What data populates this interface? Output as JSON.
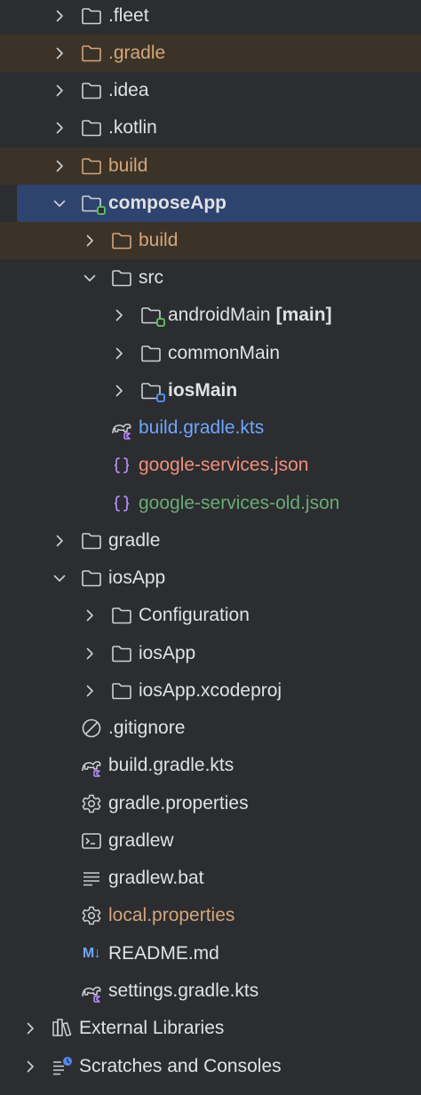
{
  "tree": {
    "fleet": ".fleet",
    "gradle_dir": ".gradle",
    "idea": ".idea",
    "kotlin": ".kotlin",
    "build": "build",
    "composeApp": "composeApp",
    "ca_build": "build",
    "src": "src",
    "androidMain": "androidMain",
    "androidMain_suffix": "[main]",
    "commonMain": "commonMain",
    "iosMain": "iosMain",
    "ca_build_gradle": "build.gradle.kts",
    "google_services": "google-services.json",
    "google_services_old": "google-services-old.json",
    "gradle": "gradle",
    "iosApp": "iosApp",
    "configuration": "Configuration",
    "iosApp_sub": "iosApp",
    "xcodeproj": "iosApp.xcodeproj",
    "gitignore": ".gitignore",
    "build_gradle": "build.gradle.kts",
    "gradle_properties": "gradle.properties",
    "gradlew": "gradlew",
    "gradlew_bat": "gradlew.bat",
    "local_properties": "local.properties",
    "readme": "README.md",
    "settings_gradle": "settings.gradle.kts",
    "external_libraries": "External Libraries",
    "scratches": "Scratches and Consoles"
  },
  "icons": {
    "markdown_badge": "M↓"
  },
  "colors": {
    "background": "#2b2d30",
    "selection": "#2e436e",
    "excluded_row": "#3b3327",
    "excluded_text": "#d6a57c",
    "modified_text": "#6ea6ff",
    "unversioned_text": "#f08f7d",
    "added_text": "#6aab73"
  }
}
